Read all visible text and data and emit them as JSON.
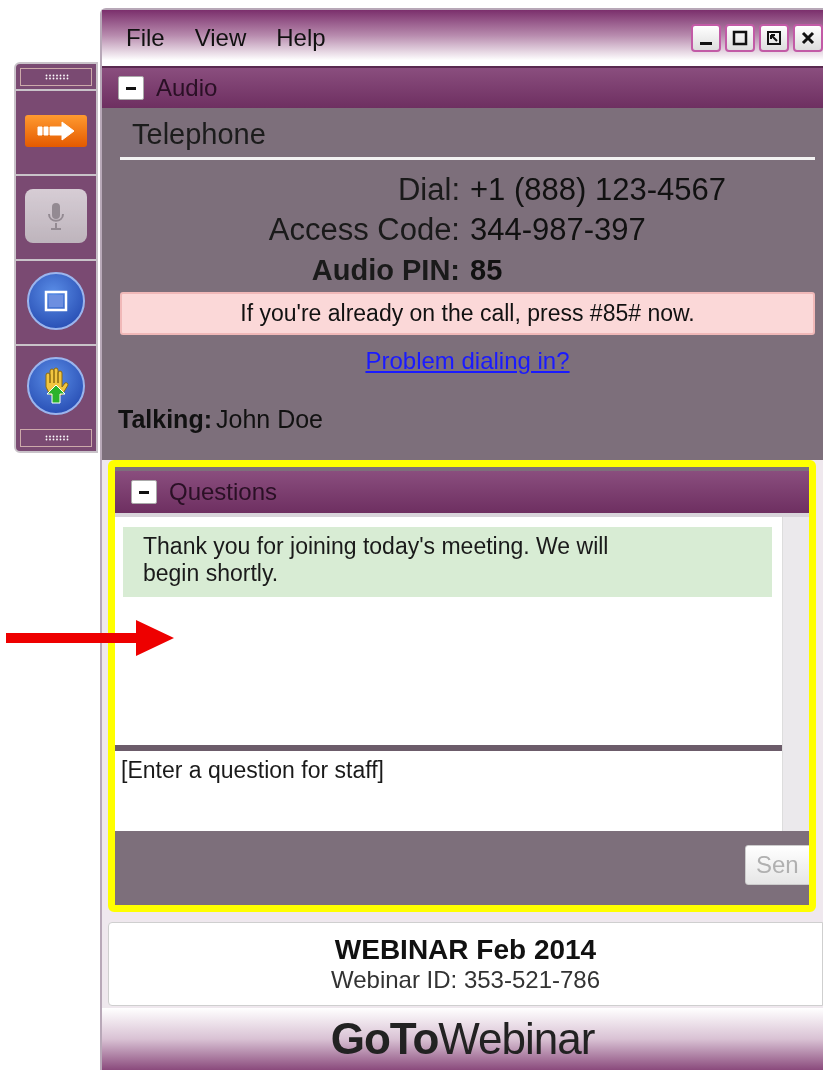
{
  "menu": [
    {
      "label": "File"
    },
    {
      "label": "View"
    },
    {
      "label": "Help"
    }
  ],
  "toolbar": [
    {
      "kind": "arrow",
      "disabled": false
    },
    {
      "kind": "mic",
      "disabled": true
    },
    {
      "kind": "screen",
      "disabled": false
    },
    {
      "kind": "hand",
      "disabled": false
    }
  ],
  "audio": {
    "title": "Audio",
    "section": "Telephone",
    "details": [
      {
        "label": "Dial:",
        "value": "+1 (888) 123-4567",
        "kind": "normal"
      },
      {
        "label": "Access Code:",
        "value": "344-987-397",
        "kind": "normal"
      },
      {
        "label": "Audio PIN:",
        "value": "85",
        "kind": "bold"
      }
    ],
    "notice": "If you're already on the call, press #85# now.",
    "link": "Problem dialing in?",
    "talking_label": "Talking:",
    "talking": "John Doe"
  },
  "questions": {
    "title": "Questions",
    "messages": [
      "Thank you for joining today's meeting. We will begin shortly."
    ],
    "placeholder": "[Enter a question for staff]",
    "send": "Sen"
  },
  "footer": {
    "title": "WEBINAR Feb 2014",
    "webinar_id": "Webinar ID: 353-521-786",
    "logo": "**GoTo**Webinar"
  }
}
